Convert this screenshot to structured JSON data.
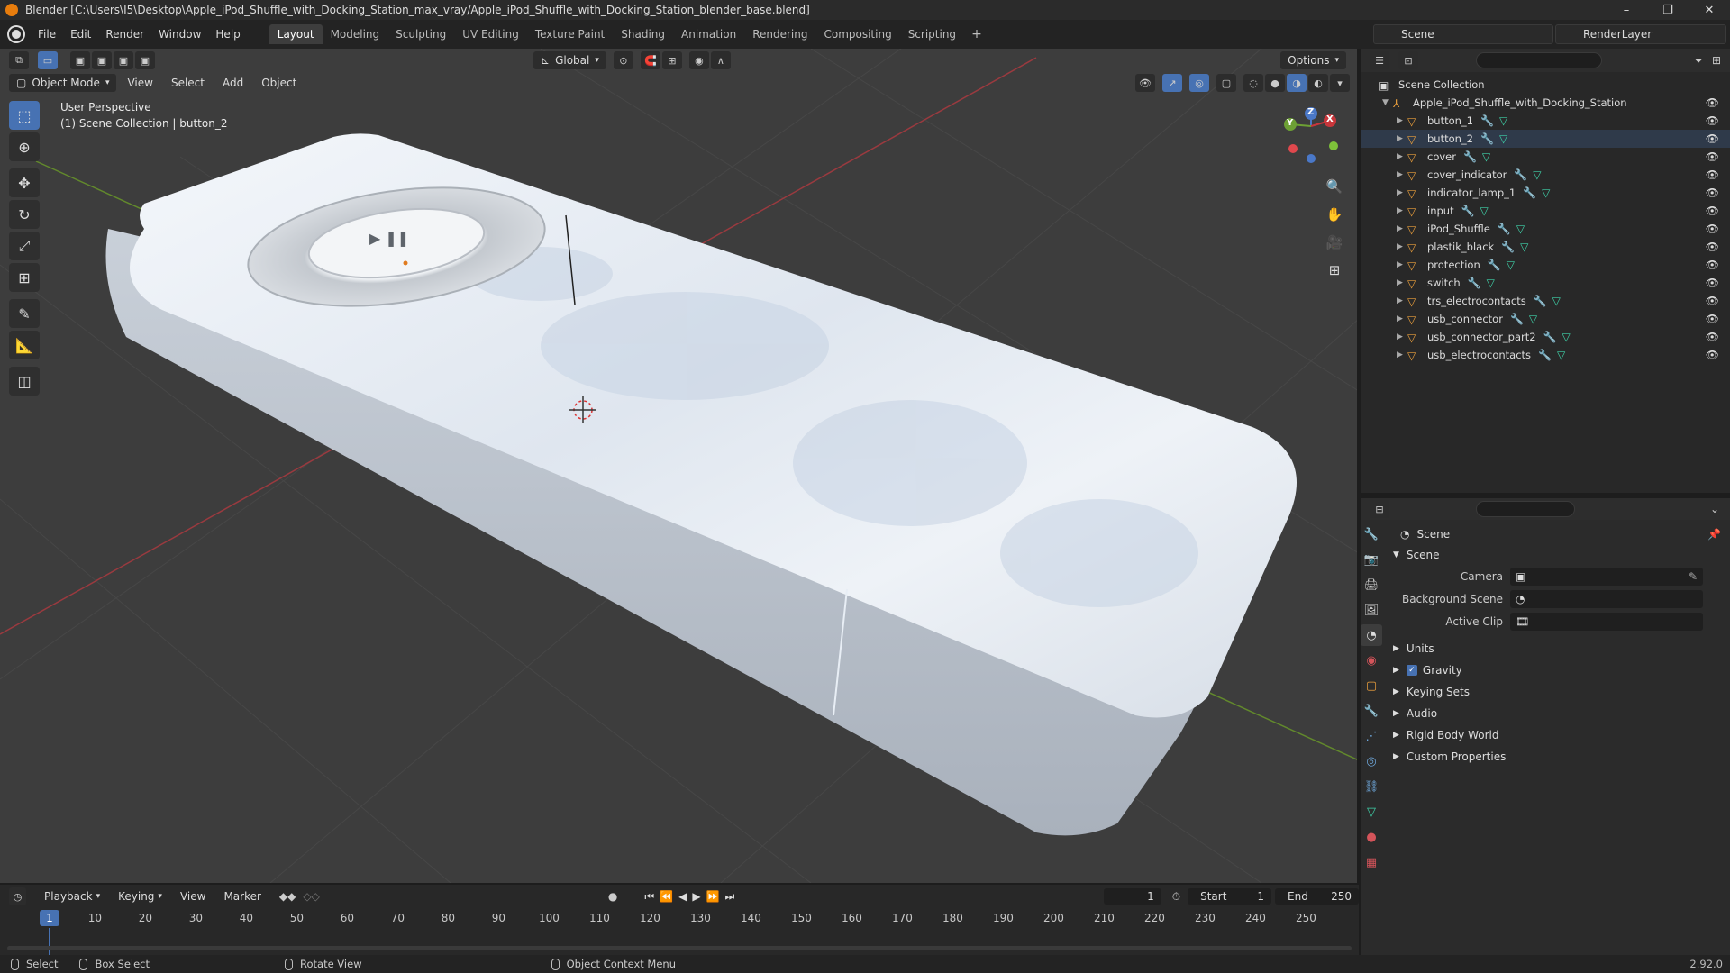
{
  "window": {
    "title": "Blender [C:\\Users\\I5\\Desktop\\Apple_iPod_Shuffle_with_Docking_Station_max_vray/Apple_iPod_Shuffle_with_Docking_Station_blender_base.blend]",
    "minimize": "–",
    "maximize": "❐",
    "close": "✕"
  },
  "menu": [
    "File",
    "Edit",
    "Render",
    "Window",
    "Help"
  ],
  "workspaces": [
    "Layout",
    "Modeling",
    "Sculpting",
    "UV Editing",
    "Texture Paint",
    "Shading",
    "Animation",
    "Rendering",
    "Compositing",
    "Scripting"
  ],
  "workspace_add": "+",
  "scene_name": "Scene",
  "render_layer": "RenderLayer",
  "viewport": {
    "transform_orientation": "Global",
    "options_label": "Options",
    "mode": "Object Mode",
    "menus": [
      "View",
      "Select",
      "Add",
      "Object"
    ],
    "perspective": "User Perspective",
    "collection_info": "(1) Scene Collection | button_2",
    "gizmo": {
      "x": "X",
      "y": "Y",
      "z": "Z"
    }
  },
  "outliner": {
    "root": "Scene Collection",
    "collection": "Apple_iPod_Shuffle_with_Docking_Station",
    "objects": [
      "button_1",
      "button_2",
      "cover",
      "cover_indicator",
      "indicator_lamp_1",
      "input",
      "iPod_Shuffle",
      "plastik_black",
      "protection",
      "switch",
      "trs_electrocontacts",
      "usb_connector",
      "usb_connector_part2",
      "usb_electrocontacts"
    ]
  },
  "properties": {
    "title": "Scene",
    "panel": "Scene",
    "fields": [
      {
        "label": "Camera",
        "value": ""
      },
      {
        "label": "Background Scene",
        "value": ""
      },
      {
        "label": "Active Clip",
        "value": ""
      }
    ],
    "subpanels": [
      "Units",
      "Gravity",
      "Keying Sets",
      "Audio",
      "Rigid Body World",
      "Custom Properties"
    ]
  },
  "timeline": {
    "menus": [
      "Playback",
      "Keying",
      "View",
      "Marker"
    ],
    "current_frame": "1",
    "start_label": "Start",
    "start": "1",
    "end_label": "End",
    "end": "250",
    "ticks": [
      "10",
      "20",
      "30",
      "40",
      "50",
      "60",
      "70",
      "80",
      "90",
      "100",
      "110",
      "120",
      "130",
      "140",
      "150",
      "160",
      "170",
      "180",
      "190",
      "200",
      "210",
      "220",
      "230",
      "240",
      "250"
    ]
  },
  "statusbar": {
    "select": "Select",
    "box_select": "Box Select",
    "rotate_view": "Rotate View",
    "context_menu": "Object Context Menu",
    "version": "2.92.0"
  },
  "colors": {
    "accent": "#4772b3",
    "object_icon": "#e99e3c",
    "mesh_icon": "#3fd1a8",
    "x_axis": "#c8363b",
    "y_axis": "#6da034"
  }
}
